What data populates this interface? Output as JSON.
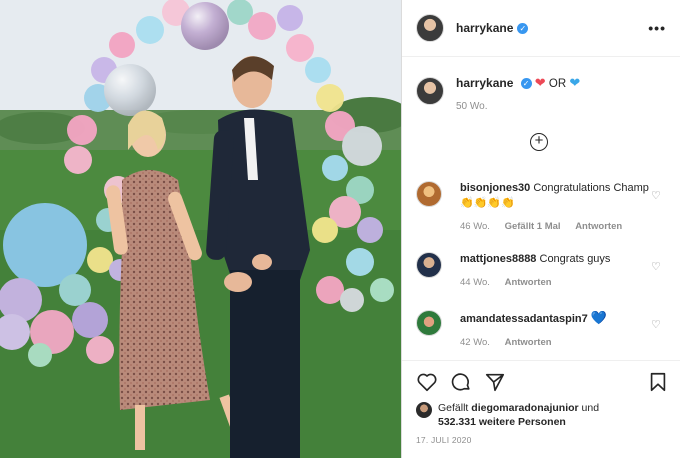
{
  "post": {
    "author": "harrykane",
    "verified_icon": "verified-badge-icon",
    "more_icon": "more-options-icon",
    "more_label": "•••"
  },
  "caption": {
    "username": "harrykane",
    "text_or": "OR",
    "heart_red": "❤",
    "heart_blue": "❤",
    "age": "50 Wo."
  },
  "comments": [
    {
      "username": "bisonjones30",
      "text": "Congratulations Champ 👏👏👏👏",
      "age": "46 Wo.",
      "likes": "Gefällt 1 Mal",
      "reply": "Antworten"
    },
    {
      "username": "mattjones8888",
      "text": "Congrats guys",
      "age": "44 Wo.",
      "reply": "Antworten"
    },
    {
      "username": "amandatessadantaspin7",
      "text": "💙",
      "age": "42 Wo.",
      "reply": "Antworten"
    }
  ],
  "likes": {
    "prefix": "Gefällt",
    "user": "diegomaradonajunior",
    "joiner": "und",
    "count": "532.331 weitere Personen"
  },
  "date": "17. JULI 2020",
  "colors": {
    "accent_blue": "#3897f0",
    "heart_red": "#ed4956",
    "heart_blue": "#3aa7e8",
    "muted": "#8e8e8e"
  }
}
